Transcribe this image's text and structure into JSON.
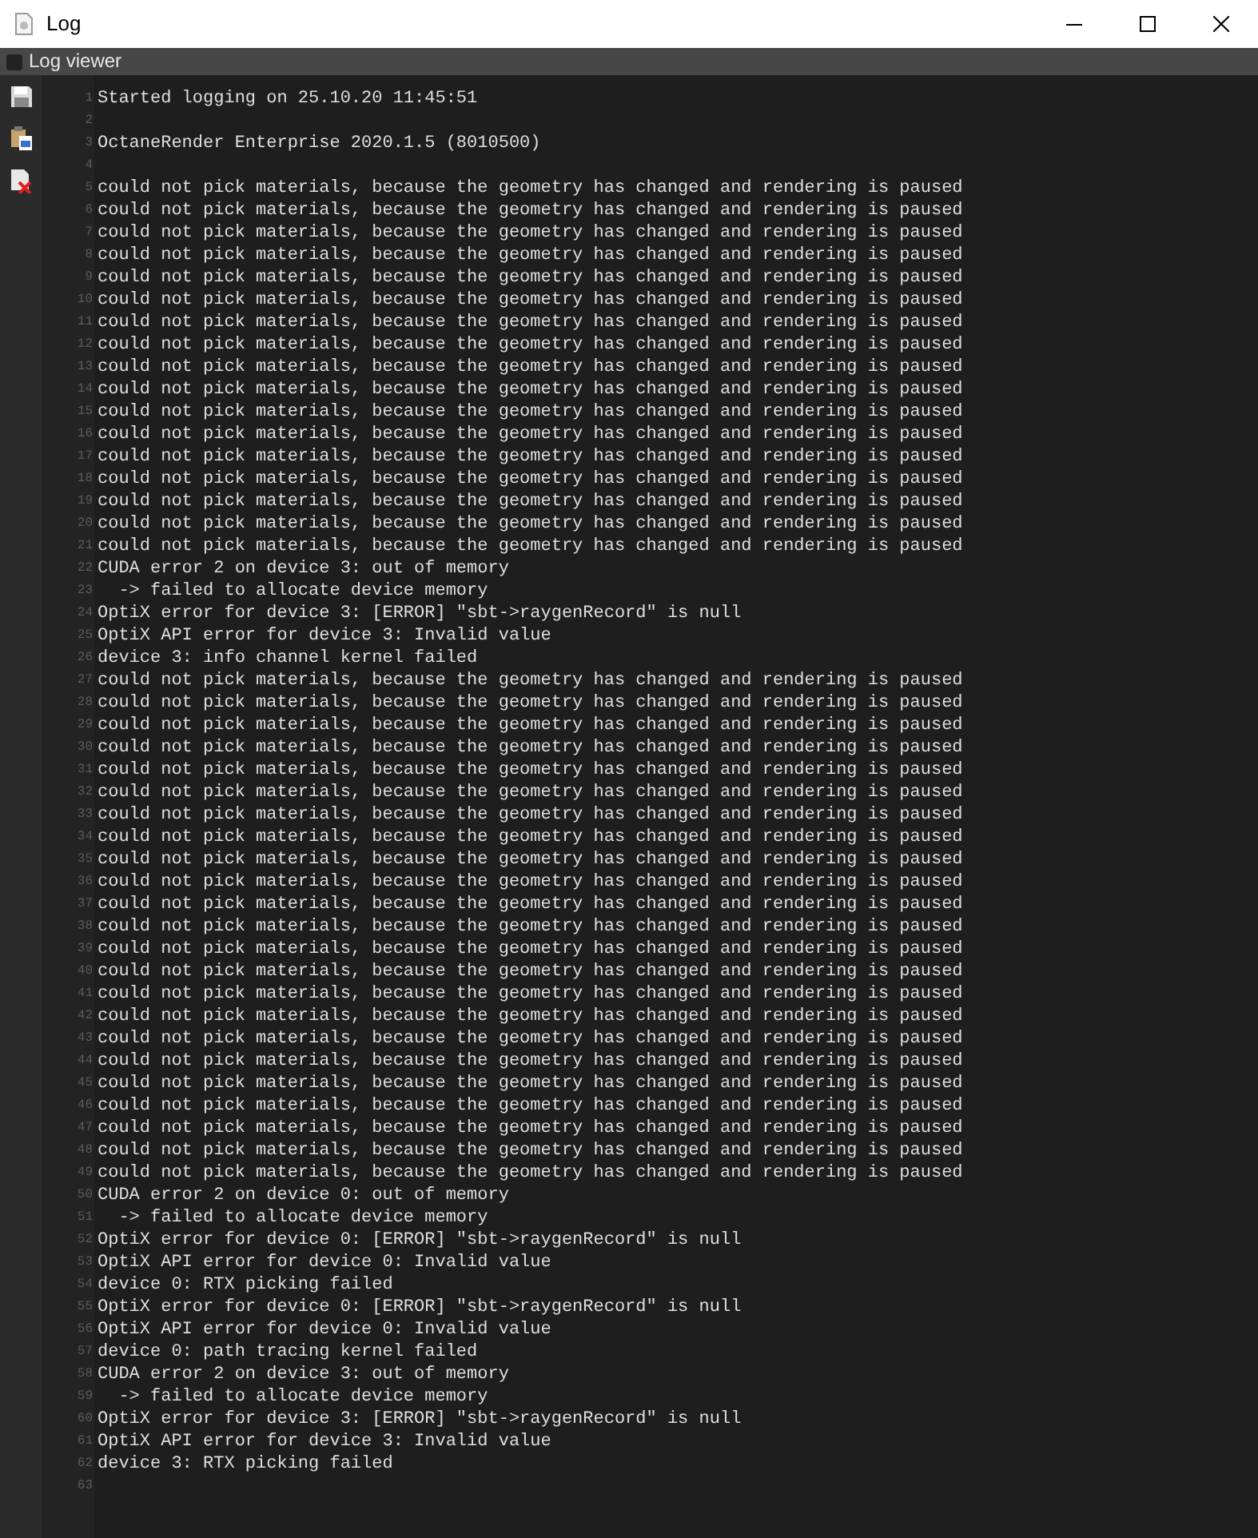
{
  "window": {
    "title": "Log"
  },
  "panel": {
    "title": "Log viewer"
  },
  "lines": [
    {
      "number": "1",
      "text": "Started logging on 25.10.20 11:45:51"
    },
    {
      "number": "2"
    },
    {
      "number": "3",
      "text": "OctaneRender Enterprise 2020.1.5 (8010500)"
    },
    {
      "number": "4"
    },
    {
      "number": "5",
      "text": "could not pick materials, because the geometry has changed and rendering is paused"
    },
    {
      "number": "6",
      "text": "could not pick materials, because the geometry has changed and rendering is paused"
    },
    {
      "number": "7",
      "text": "could not pick materials, because the geometry has changed and rendering is paused"
    },
    {
      "number": "8",
      "text": "could not pick materials, because the geometry has changed and rendering is paused"
    },
    {
      "number": "9",
      "text": "could not pick materials, because the geometry has changed and rendering is paused"
    },
    {
      "number": "10",
      "text": "could not pick materials, because the geometry has changed and rendering is paused"
    },
    {
      "number": "11",
      "text": "could not pick materials, because the geometry has changed and rendering is paused"
    },
    {
      "number": "12",
      "text": "could not pick materials, because the geometry has changed and rendering is paused"
    },
    {
      "number": "13",
      "text": "could not pick materials, because the geometry has changed and rendering is paused"
    },
    {
      "number": "14",
      "text": "could not pick materials, because the geometry has changed and rendering is paused"
    },
    {
      "number": "15",
      "text": "could not pick materials, because the geometry has changed and rendering is paused"
    },
    {
      "number": "16",
      "text": "could not pick materials, because the geometry has changed and rendering is paused"
    },
    {
      "number": "17",
      "text": "could not pick materials, because the geometry has changed and rendering is paused"
    },
    {
      "number": "18",
      "text": "could not pick materials, because the geometry has changed and rendering is paused"
    },
    {
      "number": "19",
      "text": "could not pick materials, because the geometry has changed and rendering is paused"
    },
    {
      "number": "20",
      "text": "could not pick materials, because the geometry has changed and rendering is paused"
    },
    {
      "number": "21",
      "text": "could not pick materials, because the geometry has changed and rendering is paused"
    },
    {
      "number": "22",
      "text": "CUDA error 2 on device 3: out of memory"
    },
    {
      "number": "23",
      "text": "  -> failed to allocate device memory"
    },
    {
      "number": "24",
      "text": "OptiX error for device 3: [ERROR] \"sbt->raygenRecord\" is null"
    },
    {
      "number": "25",
      "text": "OptiX API error for device 3: Invalid value"
    },
    {
      "number": "26",
      "text": "device 3: info channel kernel failed"
    },
    {
      "number": "27",
      "text": "could not pick materials, because the geometry has changed and rendering is paused"
    },
    {
      "number": "28",
      "text": "could not pick materials, because the geometry has changed and rendering is paused"
    },
    {
      "number": "29",
      "text": "could not pick materials, because the geometry has changed and rendering is paused"
    },
    {
      "number": "30",
      "text": "could not pick materials, because the geometry has changed and rendering is paused"
    },
    {
      "number": "31",
      "text": "could not pick materials, because the geometry has changed and rendering is paused"
    },
    {
      "number": "32",
      "text": "could not pick materials, because the geometry has changed and rendering is paused"
    },
    {
      "number": "33",
      "text": "could not pick materials, because the geometry has changed and rendering is paused"
    },
    {
      "number": "34",
      "text": "could not pick materials, because the geometry has changed and rendering is paused"
    },
    {
      "number": "35",
      "text": "could not pick materials, because the geometry has changed and rendering is paused"
    },
    {
      "number": "36",
      "text": "could not pick materials, because the geometry has changed and rendering is paused"
    },
    {
      "number": "37",
      "text": "could not pick materials, because the geometry has changed and rendering is paused"
    },
    {
      "number": "38",
      "text": "could not pick materials, because the geometry has changed and rendering is paused"
    },
    {
      "number": "39",
      "text": "could not pick materials, because the geometry has changed and rendering is paused"
    },
    {
      "number": "40",
      "text": "could not pick materials, because the geometry has changed and rendering is paused"
    },
    {
      "number": "41",
      "text": "could not pick materials, because the geometry has changed and rendering is paused"
    },
    {
      "number": "42",
      "text": "could not pick materials, because the geometry has changed and rendering is paused"
    },
    {
      "number": "43",
      "text": "could not pick materials, because the geometry has changed and rendering is paused"
    },
    {
      "number": "44",
      "text": "could not pick materials, because the geometry has changed and rendering is paused"
    },
    {
      "number": "45",
      "text": "could not pick materials, because the geometry has changed and rendering is paused"
    },
    {
      "number": "46",
      "text": "could not pick materials, because the geometry has changed and rendering is paused"
    },
    {
      "number": "47",
      "text": "could not pick materials, because the geometry has changed and rendering is paused"
    },
    {
      "number": "48",
      "text": "could not pick materials, because the geometry has changed and rendering is paused"
    },
    {
      "number": "49",
      "text": "could not pick materials, because the geometry has changed and rendering is paused"
    },
    {
      "number": "50",
      "text": "CUDA error 2 on device 0: out of memory"
    },
    {
      "number": "51",
      "text": "  -> failed to allocate device memory"
    },
    {
      "number": "52",
      "text": "OptiX error for device 0: [ERROR] \"sbt->raygenRecord\" is null"
    },
    {
      "number": "53",
      "text": "OptiX API error for device 0: Invalid value"
    },
    {
      "number": "54",
      "text": "device 0: RTX picking failed"
    },
    {
      "number": "55",
      "text": "OptiX error for device 0: [ERROR] \"sbt->raygenRecord\" is null"
    },
    {
      "number": "56",
      "text": "OptiX API error for device 0: Invalid value"
    },
    {
      "number": "57",
      "text": "device 0: path tracing kernel failed"
    },
    {
      "number": "58",
      "text": "CUDA error 2 on device 3: out of memory"
    },
    {
      "number": "59",
      "text": "  -> failed to allocate device memory"
    },
    {
      "number": "60",
      "text": "OptiX error for device 3: [ERROR] \"sbt->raygenRecord\" is null"
    },
    {
      "number": "61",
      "text": "OptiX API error for device 3: Invalid value"
    },
    {
      "number": "62",
      "text": "device 3: RTX picking failed"
    },
    {
      "number": "63"
    }
  ]
}
